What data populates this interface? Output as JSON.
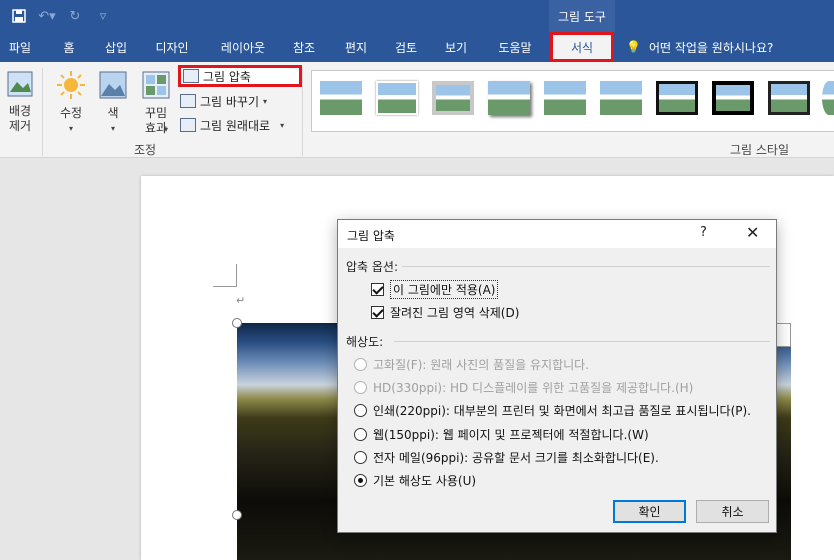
{
  "quick_access": {
    "save_icon": "save-icon",
    "undo_icon": "undo-icon",
    "redo_icon": "redo-icon",
    "customize_icon": "customize-qat-icon"
  },
  "context_tab_title": "그림 도구",
  "tabs": [
    {
      "label": "파일"
    },
    {
      "label": "홈"
    },
    {
      "label": "삽입"
    },
    {
      "label": "디자인"
    },
    {
      "label": "레이아웃"
    },
    {
      "label": "참조"
    },
    {
      "label": "편지"
    },
    {
      "label": "검토"
    },
    {
      "label": "보기"
    },
    {
      "label": "도움말"
    },
    {
      "label": "서식"
    }
  ],
  "tell_me": "어떤 작업을 원하시나요?",
  "ribbon": {
    "remove_bg": "배경\n제거",
    "corrections": "수정",
    "color": "색",
    "artistic_effects": "꾸밈\n효과",
    "compress": "그림 압축",
    "change_picture": "그림 바꾸기",
    "reset_picture": "그림 원래대로",
    "adjust_group": "조정",
    "styles_group": "그림 스타일"
  },
  "dialog": {
    "title": "그림 압축",
    "help": "?",
    "close": "✕",
    "compress_options_label": "압축 옵션:",
    "apply_only_this": "이 그림에만 적용(A)",
    "delete_cropped": "잘려진 그림 영역 삭제(D)",
    "resolution_label": "해상도:",
    "options": [
      {
        "label": "고화질(F): 원래 사진의 품질을 유지합니다.",
        "enabled": false,
        "selected": false
      },
      {
        "label": "HD(330ppi): HD 디스플레이를 위한 고품질을 제공합니다.(H)",
        "enabled": false,
        "selected": false
      },
      {
        "label": "인쇄(220ppi): 대부분의 프린터 및 화면에서 최고급 품질로 표시됩니다(P).",
        "enabled": true,
        "selected": false
      },
      {
        "label": "웹(150ppi): 웹 페이지 및 프로젝터에 적절합니다.(W)",
        "enabled": true,
        "selected": false
      },
      {
        "label": "전자 메일(96ppi): 공유할 문서 크기를 최소화합니다(E).",
        "enabled": true,
        "selected": false
      },
      {
        "label": "기본 해상도 사용(U)",
        "enabled": true,
        "selected": true
      }
    ],
    "ok": "확인",
    "cancel": "취소"
  },
  "colors": {
    "accent": "#2b579a",
    "highlight": "#e0161c"
  }
}
